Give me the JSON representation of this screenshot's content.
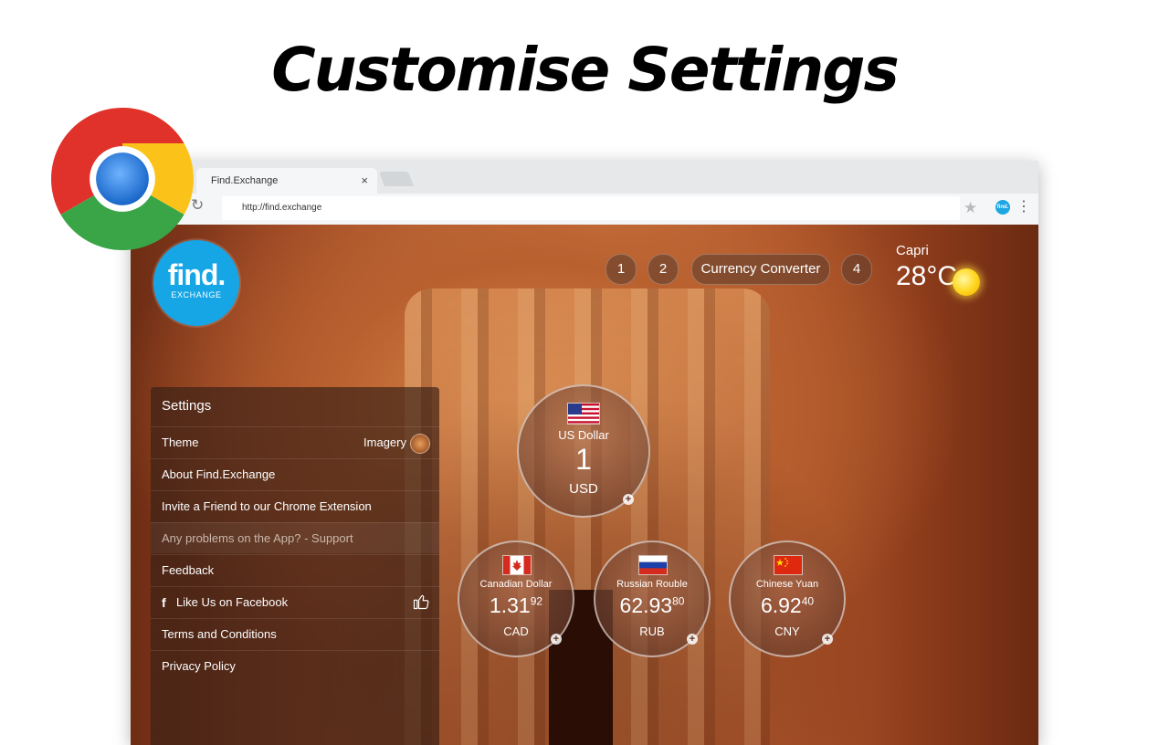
{
  "headline": "Customise Settings",
  "browser": {
    "tab_title": "Find.Exchange",
    "tab_close": "×",
    "url": "http://find.exchange",
    "reload": "↻",
    "star": "★",
    "extension_label": "find.",
    "menu": "⋮"
  },
  "logo": {
    "word": "find.",
    "sub": "EXCHANGE",
    "color": "#16a6e6"
  },
  "nav": {
    "items": [
      {
        "label": "1"
      },
      {
        "label": "2"
      },
      {
        "label": "Currency Converter"
      },
      {
        "label": "4"
      }
    ]
  },
  "weather": {
    "city": "Capri",
    "temp": "28°C"
  },
  "settings": {
    "title": "Settings",
    "theme_label": "Theme",
    "theme_value": "Imagery",
    "items": [
      {
        "label": "About Find.Exchange"
      },
      {
        "label": "Invite a Friend to our Chrome Extension"
      },
      {
        "label": "Any problems on the App? - Support"
      },
      {
        "label": "Feedback"
      }
    ],
    "facebook_icon": "f",
    "facebook_label": "Like Us on Facebook",
    "items_after": [
      {
        "label": "Terms and Conditions"
      },
      {
        "label": "Privacy Policy"
      }
    ]
  },
  "currencies": {
    "base": {
      "name": "US Dollar",
      "value": "1",
      "code": "USD",
      "flag": "us-flag"
    },
    "cad": {
      "name": "Canadian Dollar",
      "main": "1.31",
      "fraction": "92",
      "code": "CAD",
      "flag": "canada-flag"
    },
    "rub": {
      "name": "Russian Rouble",
      "main": "62.93",
      "fraction": "80",
      "code": "RUB",
      "flag": "russia-flag"
    },
    "cny": {
      "name": "Chinese Yuan",
      "main": "6.92",
      "fraction": "40",
      "code": "CNY",
      "flag": "china-flag"
    },
    "plus": "+"
  }
}
